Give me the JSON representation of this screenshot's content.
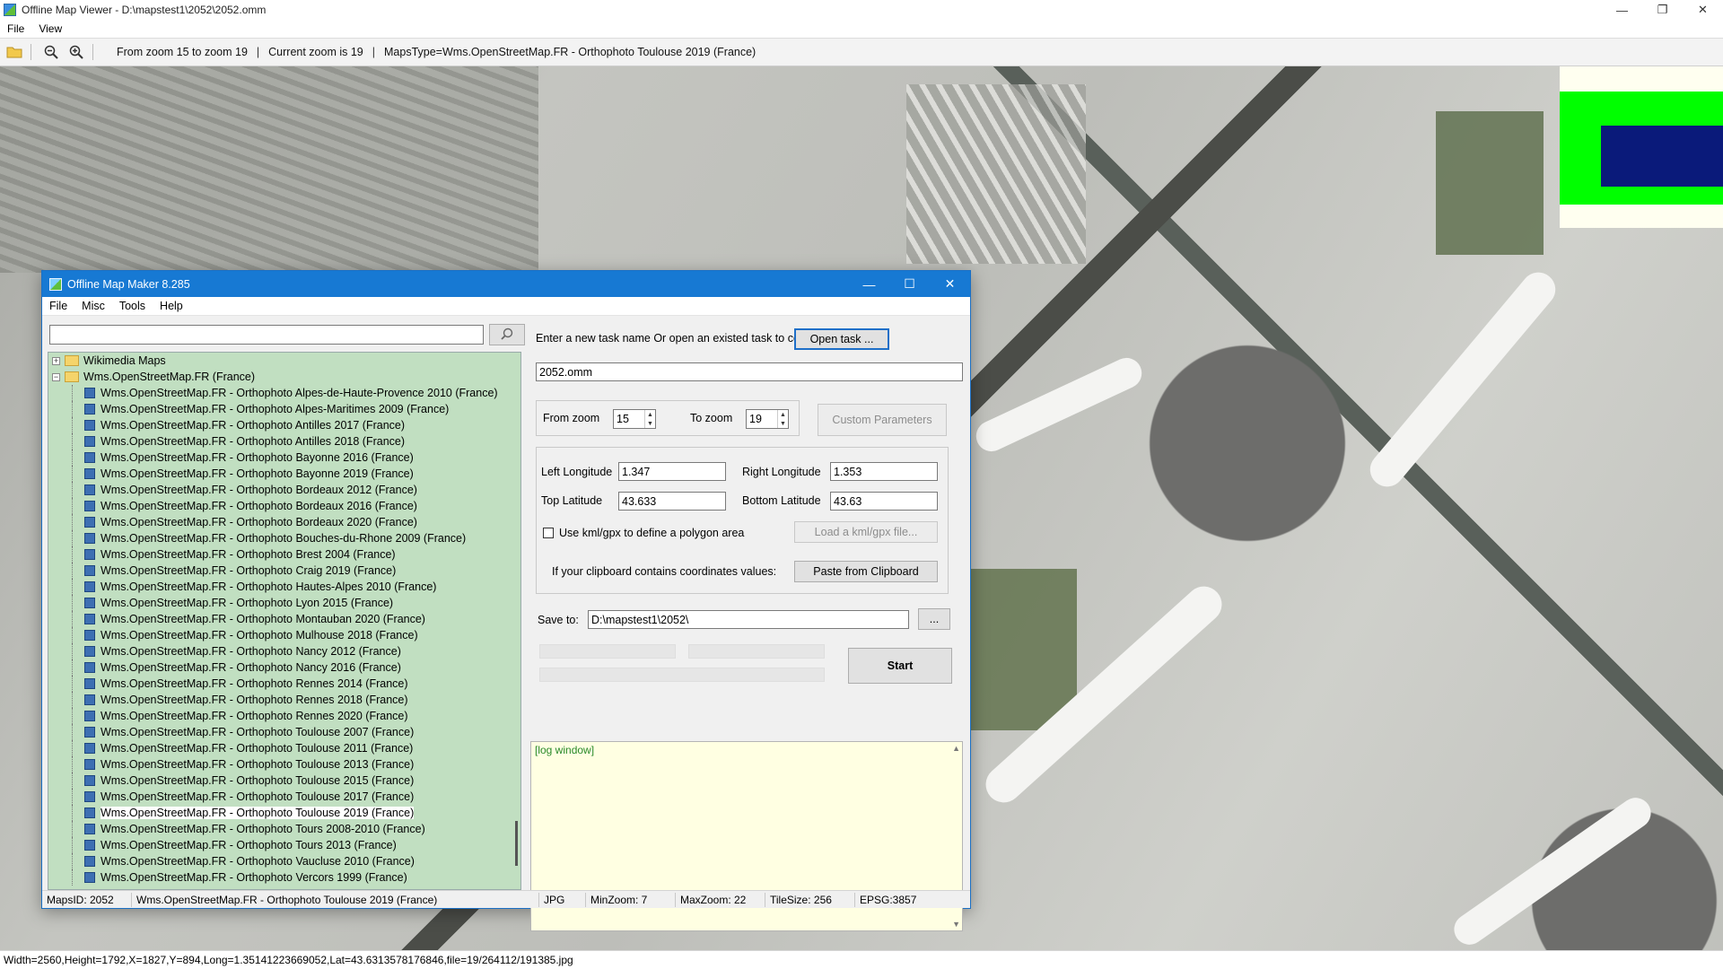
{
  "viewer": {
    "title": "Offline Map Viewer - D:\\mapstest1\\2052\\2052.omm",
    "menu": [
      "File",
      "View"
    ],
    "toolbar": {
      "zoom_range": "From zoom 15 to zoom 19",
      "current_zoom": "Current zoom is 19",
      "maps_type": "MapsType=Wms.OpenStreetMap.FR - Orthophoto Toulouse 2019 (France)"
    },
    "status": "Width=2560,Height=1792,X=1827,Y=894,Long=1.35141223669052,Lat=43.6313578176846,file=19/264112/191385.jpg"
  },
  "dialog": {
    "title": "Offline Map Maker 8.285",
    "menu": [
      "File",
      "Misc",
      "Tools",
      "Help"
    ],
    "search": {
      "value": "",
      "placeholder": ""
    },
    "tree": {
      "root1": "Wikimedia Maps",
      "root2": "Wms.OpenStreetMap.FR (France)",
      "items": [
        "Wms.OpenStreetMap.FR - Orthophoto Alpes-de-Haute-Provence 2010 (France)",
        "Wms.OpenStreetMap.FR - Orthophoto Alpes-Maritimes 2009 (France)",
        "Wms.OpenStreetMap.FR - Orthophoto Antilles 2017 (France)",
        "Wms.OpenStreetMap.FR - Orthophoto Antilles 2018 (France)",
        "Wms.OpenStreetMap.FR - Orthophoto Bayonne 2016 (France)",
        "Wms.OpenStreetMap.FR - Orthophoto Bayonne 2019 (France)",
        "Wms.OpenStreetMap.FR - Orthophoto Bordeaux 2012 (France)",
        "Wms.OpenStreetMap.FR - Orthophoto Bordeaux 2016 (France)",
        "Wms.OpenStreetMap.FR - Orthophoto Bordeaux 2020 (France)",
        "Wms.OpenStreetMap.FR - Orthophoto Bouches-du-Rhone 2009 (France)",
        "Wms.OpenStreetMap.FR - Orthophoto Brest 2004 (France)",
        "Wms.OpenStreetMap.FR - Orthophoto Craig 2019 (France)",
        "Wms.OpenStreetMap.FR - Orthophoto Hautes-Alpes 2010 (France)",
        "Wms.OpenStreetMap.FR - Orthophoto Lyon 2015 (France)",
        "Wms.OpenStreetMap.FR - Orthophoto Montauban 2020 (France)",
        "Wms.OpenStreetMap.FR - Orthophoto Mulhouse 2018 (France)",
        "Wms.OpenStreetMap.FR - Orthophoto Nancy 2012 (France)",
        "Wms.OpenStreetMap.FR - Orthophoto Nancy 2016 (France)",
        "Wms.OpenStreetMap.FR - Orthophoto Rennes 2014 (France)",
        "Wms.OpenStreetMap.FR - Orthophoto Rennes 2018 (France)",
        "Wms.OpenStreetMap.FR - Orthophoto Rennes 2020 (France)",
        "Wms.OpenStreetMap.FR - Orthophoto Toulouse 2007 (France)",
        "Wms.OpenStreetMap.FR - Orthophoto Toulouse 2011 (France)",
        "Wms.OpenStreetMap.FR - Orthophoto Toulouse 2013 (France)",
        "Wms.OpenStreetMap.FR - Orthophoto Toulouse 2015 (France)",
        "Wms.OpenStreetMap.FR - Orthophoto Toulouse 2017 (France)",
        "Wms.OpenStreetMap.FR - Orthophoto Toulouse 2019 (France)",
        "Wms.OpenStreetMap.FR - Orthophoto Tours 2008-2010 (France)",
        "Wms.OpenStreetMap.FR - Orthophoto Tours 2013 (France)",
        "Wms.OpenStreetMap.FR - Orthophoto Vaucluse 2010 (France)",
        "Wms.OpenStreetMap.FR - Orthophoto Vercors 1999 (France)"
      ],
      "selected_item": "Wms.OpenStreetMap.FR - Orthophoto Toulouse 2019 (France)"
    },
    "task": {
      "prompt": "Enter a new task name Or open an existed task to continue:",
      "open_button": "Open task ...",
      "task_name": "2052.omm"
    },
    "zoom": {
      "from_label": "From zoom",
      "from_value": "15",
      "to_label": "To zoom",
      "to_value": "19",
      "custom_button": "Custom Parameters"
    },
    "coords": {
      "left_lon_label": "Left Longitude",
      "left_lon": "1.347",
      "right_lon_label": "Right Longitude",
      "right_lon": "1.353",
      "top_lat_label": "Top Latitude",
      "top_lat": "43.633",
      "bottom_lat_label": "Bottom Latitude",
      "bottom_lat": "43.63",
      "kml_checkbox_label": "Use kml/gpx to define a polygon area",
      "kml_checked": false,
      "load_kml_button": "Load a kml/gpx file...",
      "clipboard_label": "If your clipboard contains coordinates values:",
      "paste_button": "Paste from Clipboard"
    },
    "save": {
      "label": "Save to:",
      "path": "D:\\mapstest1\\2052\\",
      "browse_button": "...",
      "start_button": "Start"
    },
    "log": {
      "text": "[log window]"
    },
    "status": {
      "maps_id": "MapsID: 2052",
      "maps_name": "Wms.OpenStreetMap.FR - Orthophoto Toulouse 2019 (France)",
      "format": "JPG",
      "min_zoom": "MinZoom: 7",
      "max_zoom": "MaxZoom: 22",
      "tile_size": "TileSize: 256",
      "epsg": "EPSG:3857"
    }
  },
  "colors": {
    "dialog_title_bg": "#1779d3",
    "tree_bg": "#c1dfc1",
    "log_bg": "#ffffe2",
    "minimap_green": "#00ff00",
    "minimap_blue": "#0a1a7a"
  }
}
